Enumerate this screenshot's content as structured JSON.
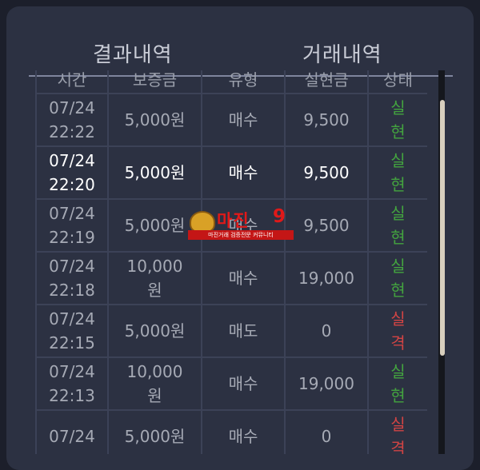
{
  "tabs": {
    "results": "결과내역",
    "trades": "거래내역"
  },
  "columns": [
    "시간",
    "보증금",
    "유형",
    "실현금",
    "상태"
  ],
  "rows": [
    {
      "date": "07/24",
      "time": "22:22",
      "deposit": "5,000원",
      "type": "매수",
      "amount": "9,500",
      "status": "실현",
      "highlight": false,
      "status_kind": "ok"
    },
    {
      "date": "07/24",
      "time": "22:20",
      "deposit": "5,000원",
      "type": "매수",
      "amount": "9,500",
      "status": "실현",
      "highlight": true,
      "status_kind": "ok"
    },
    {
      "date": "07/24",
      "time": "22:19",
      "deposit": "5,000원",
      "type": "매수",
      "amount": "9,500",
      "status": "실현",
      "highlight": false,
      "status_kind": "ok"
    },
    {
      "date": "07/24",
      "time": "22:18",
      "deposit": "10,000원",
      "type": "매수",
      "amount": "19,000",
      "status": "실현",
      "highlight": false,
      "status_kind": "ok"
    },
    {
      "date": "07/24",
      "time": "22:15",
      "deposit": "5,000원",
      "type": "매도",
      "amount": "0",
      "status": "실격",
      "highlight": false,
      "status_kind": "fail"
    },
    {
      "date": "07/24",
      "time": "22:13",
      "deposit": "10,000원",
      "type": "매수",
      "amount": "19,000",
      "status": "실현",
      "highlight": false,
      "status_kind": "ok"
    },
    {
      "date": "07/24",
      "time": "",
      "deposit": "5,000원",
      "type": "매수",
      "amount": "0",
      "status": "실격",
      "highlight": false,
      "status_kind": "fail"
    }
  ],
  "watermark": {
    "title": "마진",
    "number": "9",
    "tagline": "마진거래 검증전문 커뮤니티"
  },
  "colors": {
    "ok": "#43a33f",
    "fail": "#d14444",
    "panel": "#2c3142",
    "background": "#1c1f2b"
  }
}
